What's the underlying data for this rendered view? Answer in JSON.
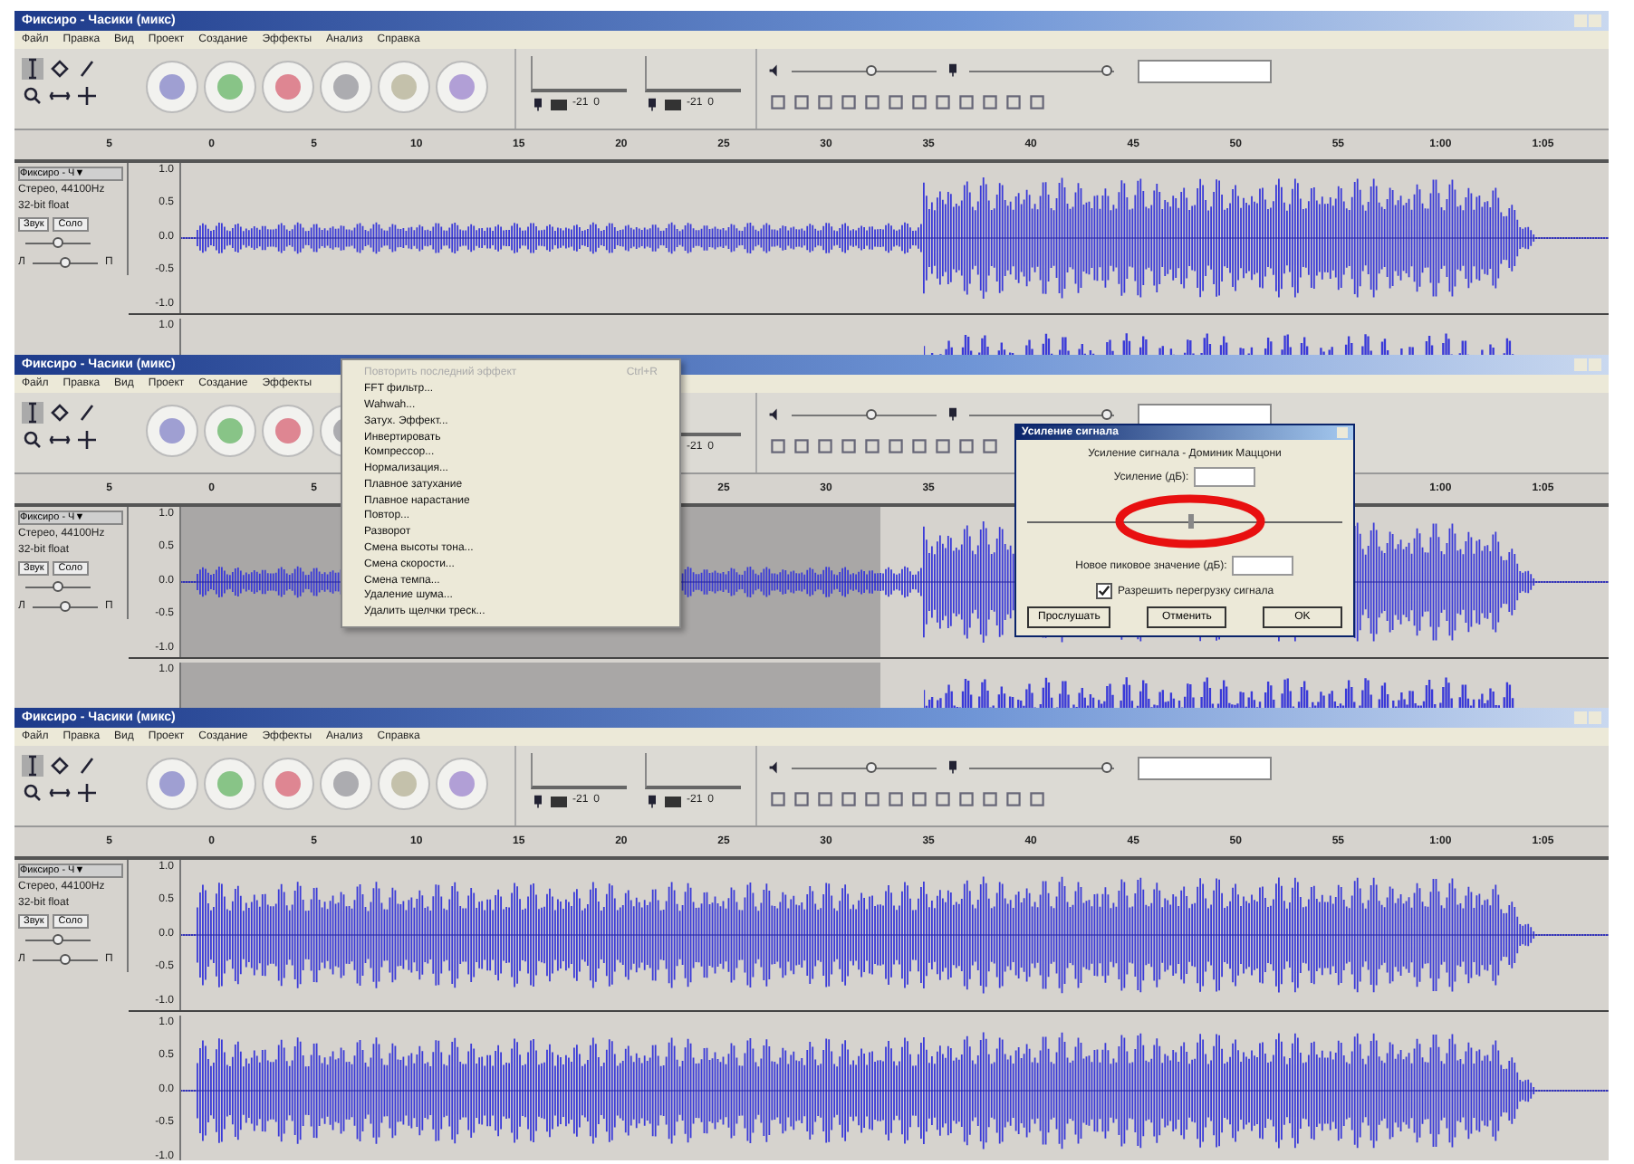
{
  "screens": [
    {
      "window": {
        "title": "Фиксиро - Часики (микс)"
      },
      "menu": [
        "Файл",
        "Правка",
        "Вид",
        "Проект",
        "Создание",
        "Эффекты",
        "Анализ",
        "Справка"
      ],
      "meters": [
        {
          "labels": [
            "-21",
            "0"
          ]
        },
        {
          "labels": [
            "-21",
            "0"
          ]
        }
      ],
      "mixer": {
        "volume": {
          "level": 0.55
        },
        "mic": {
          "level": 0.95
        }
      },
      "ruler": [
        "5",
        "0",
        "5",
        "10",
        "15",
        "20",
        "25",
        "30",
        "35",
        "40",
        "45",
        "50",
        "55",
        "1:00",
        "1:05"
      ],
      "tracks": [
        {
          "name": "Фиксиро - Ч▼",
          "info": [
            "Стерео, 44100Hz",
            "32-bit float"
          ],
          "mute": "Звук",
          "solo": "Соло",
          "gain": {
            "level": 0.5
          },
          "pan": {
            "labels": [
              "Л",
              "П"
            ],
            "level": 0.5
          },
          "channels": [
            {
              "scale": [
                "1.0",
                "0.5",
                "0.0",
                "-0.5",
                "-1.0"
              ]
            },
            {
              "scale": [
                "1.0"
              ]
            }
          ]
        }
      ],
      "selected": false
    },
    {
      "window": {
        "title": "Фиксиро - Часики (микс)"
      },
      "menu": [
        "Файл",
        "Правка",
        "Вид",
        "Проект",
        "Создание",
        "Эффекты"
      ],
      "meters": [
        {
          "labels": [
            "-21",
            "0"
          ]
        }
      ],
      "mixer": {
        "volume": {
          "level": 0.55
        },
        "mic": {
          "level": 0.95
        }
      },
      "ruler": [
        [
          "5",
          "0",
          "5"
        ],
        [
          "25",
          "30",
          "35"
        ],
        [
          "1:00",
          "1:05"
        ]
      ],
      "tracks": [
        {
          "name": "Фиксиро - Ч▼",
          "info": [
            "Стерео, 44100Hz",
            "32-bit float"
          ],
          "mute": "Звук",
          "solo": "Соло",
          "gain": {
            "level": 0.5
          },
          "pan": {
            "labels": [
              "Л",
              "П"
            ],
            "level": 0.5
          },
          "channels": [
            {
              "scale": [
                "1.0",
                "0.5",
                "0.0",
                "-0.5",
                "-1.0"
              ]
            },
            {
              "scale": [
                "1.0"
              ]
            }
          ]
        }
      ],
      "selected": true,
      "effects_menu": {
        "items": [
          {
            "label": "Повторить последний эффект",
            "shortcut": "Ctrl+R",
            "disabled": true
          },
          {
            "label": "FFT фильтр...",
            "disabled": false
          },
          {
            "label": "Wahwah...",
            "disabled": false
          },
          {
            "label": "Затух. Эффект...",
            "disabled": false
          },
          {
            "label": "Инвертировать",
            "disabled": false
          },
          {
            "label": "Компрессор...",
            "disabled": false
          },
          {
            "label": "Нормализация...",
            "disabled": false
          },
          {
            "label": "Плавное затухание",
            "disabled": false
          },
          {
            "label": "Плавное нарастание",
            "disabled": false
          },
          {
            "label": "Повтор...",
            "disabled": false
          },
          {
            "label": "Разворот",
            "disabled": false
          },
          {
            "label": "Смена высоты тона...",
            "disabled": false
          },
          {
            "label": "Смена скорости...",
            "disabled": false
          },
          {
            "label": "Смена темпа...",
            "disabled": false
          },
          {
            "label": "Удаление шума...",
            "disabled": false
          },
          {
            "label": "Удалить щелчки треск...",
            "disabled": false
          }
        ]
      },
      "dialog": {
        "title": "Усиление сигнала",
        "subtitle": "Усиление сигнала - Доминик Маццони",
        "gain_label": "Усиление (дБ):",
        "slider": {
          "level": 0.52
        },
        "peak_label": "Новое пиковое значение (дБ):",
        "checkbox": {
          "label": "Разрешить перегрузку сигнала",
          "checked": true
        },
        "buttons": [
          "Прослушать",
          "Отменить",
          "OK"
        ]
      }
    },
    {
      "window": {
        "title": "Фиксиро - Часики (микс)"
      },
      "menu": [
        "Файл",
        "Правка",
        "Вид",
        "Проект",
        "Создание",
        "Эффекты",
        "Анализ",
        "Справка"
      ],
      "meters": [
        {
          "labels": [
            "-21",
            "0"
          ]
        },
        {
          "labels": [
            "-21",
            "0"
          ]
        }
      ],
      "mixer": {
        "volume": {
          "level": 0.55
        },
        "mic": {
          "level": 0.95
        }
      },
      "ruler": [
        "5",
        "0",
        "5",
        "10",
        "15",
        "20",
        "25",
        "30",
        "35",
        "40",
        "45",
        "50",
        "55",
        "1:00",
        "1:05"
      ],
      "tracks": [
        {
          "name": "Фиксиро - Ч▼",
          "info": [
            "Стерео, 44100Hz",
            "32-bit float"
          ],
          "mute": "Звук",
          "solo": "Соло",
          "gain": {
            "level": 0.5
          },
          "pan": {
            "labels": [
              "Л",
              "П"
            ],
            "level": 0.5
          },
          "channels": [
            {
              "scale": [
                "1.0",
                "0.5",
                "0.0",
                "-0.5",
                "-1.0"
              ]
            },
            {
              "scale": [
                "1.0",
                "0.5",
                "0.0",
                "-0.5",
                "-1.0"
              ]
            }
          ]
        }
      ],
      "selected": false
    }
  ]
}
